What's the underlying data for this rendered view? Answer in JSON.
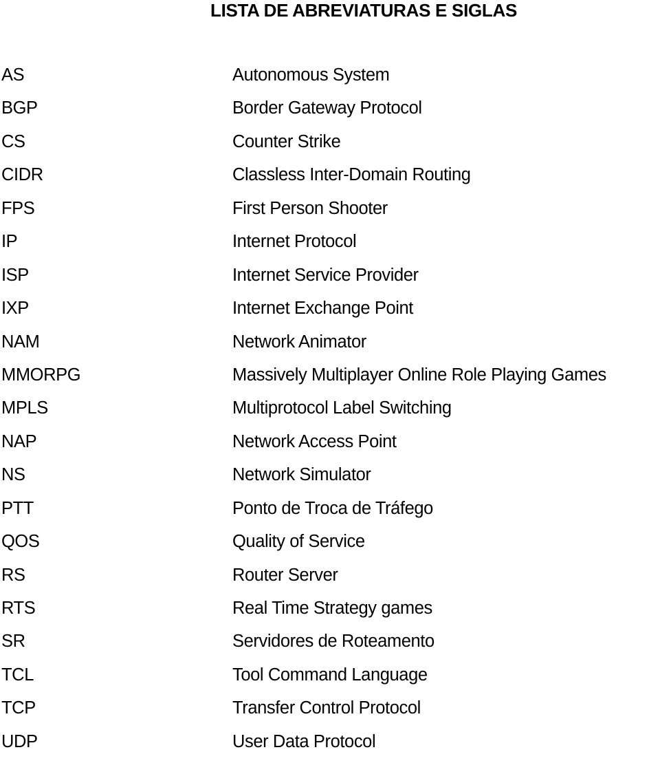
{
  "title": "LISTA DE ABREVIATURAS E SIGLAS",
  "entries": [
    {
      "abbr": "AS",
      "desc": "Autonomous System"
    },
    {
      "abbr": "BGP",
      "desc": "Border Gateway Protocol"
    },
    {
      "abbr": "CS",
      "desc": "Counter Strike"
    },
    {
      "abbr": "CIDR",
      "desc": "Classless Inter-Domain Routing"
    },
    {
      "abbr": "FPS",
      "desc": "First Person Shooter"
    },
    {
      "abbr": "IP",
      "desc": "Internet Protocol"
    },
    {
      "abbr": "ISP",
      "desc": "Internet Service Provider"
    },
    {
      "abbr": "IXP",
      "desc": "Internet Exchange Point"
    },
    {
      "abbr": "NAM",
      "desc": "Network Animator"
    },
    {
      "abbr": "MMORPG",
      "desc": "Massively Multiplayer Online Role Playing Games"
    },
    {
      "abbr": "MPLS",
      "desc": "Multiprotocol Label Switching"
    },
    {
      "abbr": "NAP",
      "desc": "Network Access Point"
    },
    {
      "abbr": "NS",
      "desc": "Network Simulator"
    },
    {
      "abbr": "PTT",
      "desc": "Ponto de Troca de Tráfego"
    },
    {
      "abbr": "QOS",
      "desc": "Quality of Service"
    },
    {
      "abbr": "RS",
      "desc": "Router Server"
    },
    {
      "abbr": "RTS",
      "desc": "Real Time Strategy games"
    },
    {
      "abbr": "SR",
      "desc": "Servidores de Roteamento"
    },
    {
      "abbr": "TCL",
      "desc": "Tool Command Language"
    },
    {
      "abbr": "TCP",
      "desc": "Transfer Control Protocol"
    },
    {
      "abbr": "UDP",
      "desc": "User Data Protocol"
    }
  ]
}
